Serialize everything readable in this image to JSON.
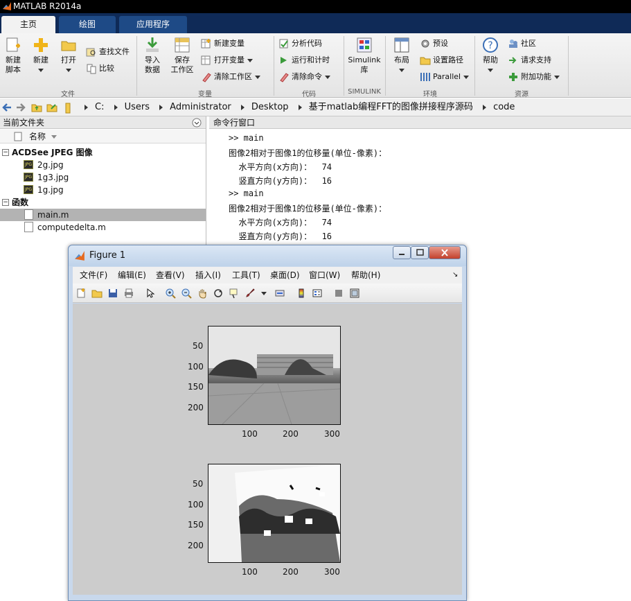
{
  "window": {
    "title": "MATLAB R2014a"
  },
  "tabs": [
    {
      "label": "主页"
    },
    {
      "label": "绘图"
    },
    {
      "label": "应用程序"
    }
  ],
  "ribbon": {
    "file_group": {
      "new_script": "新建\n脚本",
      "new": "新建",
      "open": "打开",
      "find_files": "查找文件",
      "compare": "比较",
      "label": "文件"
    },
    "variable_group": {
      "import": "导入\n数据",
      "save_workspace": "保存\n工作区",
      "new_variable": "新建变量",
      "open_variable": "打开变量",
      "clear_workspace": "清除工作区",
      "label": "变量"
    },
    "code_group": {
      "analyze": "分析代码",
      "run_time": "运行和计时",
      "clear_commands": "清除命令",
      "label": "代码"
    },
    "simulink_group": {
      "library": "Simulink\n库",
      "label": "SIMULINK"
    },
    "env_group": {
      "layout": "布局",
      "preferences": "预设",
      "set_path": "设置路径",
      "parallel": "Parallel",
      "label": "环境"
    },
    "resources_group": {
      "help": "帮助",
      "community": "社区",
      "support": "请求支持",
      "addons": "附加功能",
      "label": "资源"
    }
  },
  "address": {
    "crumbs": [
      "C:",
      "Users",
      "Administrator",
      "Desktop",
      "基于matlab编程FFT的图像拼接程序源码",
      "code"
    ]
  },
  "current_folder": {
    "title": "当前文件夹",
    "column_name": "名称",
    "groups": [
      {
        "label": "ACDSee JPEG 图像",
        "files": [
          "2g.jpg",
          "1g3.jpg",
          "1g.jpg"
        ]
      },
      {
        "label": "函数",
        "files": [
          "main.m",
          "computedelta.m"
        ]
      }
    ],
    "selected": "main.m"
  },
  "command_window": {
    "title": "命令行窗口",
    "lines": [
      ">> main",
      "图像2相对于图像1的位移量(单位-像素)：",
      "  水平方向(x方向)：  74",
      "  竖直方向(y方向)：  16",
      ">> main",
      "图像2相对于图像1的位移量(单位-像素)：",
      "  水平方向(x方向)：  74",
      "  竖直方向(y方向)：  16"
    ]
  },
  "figure": {
    "title": "Figure 1",
    "menu": [
      "文件(F)",
      "编辑(E)",
      "查看(V)",
      "插入(I)",
      "工具(T)",
      "桌面(D)",
      "窗口(W)",
      "帮助(H)"
    ],
    "axes1": {
      "yticks": [
        "50",
        "100",
        "150",
        "200"
      ],
      "xticks": [
        "100",
        "200",
        "300"
      ]
    },
    "axes2": {
      "yticks": [
        "50",
        "100",
        "150",
        "200"
      ],
      "xticks": [
        "100",
        "200",
        "300"
      ]
    }
  }
}
